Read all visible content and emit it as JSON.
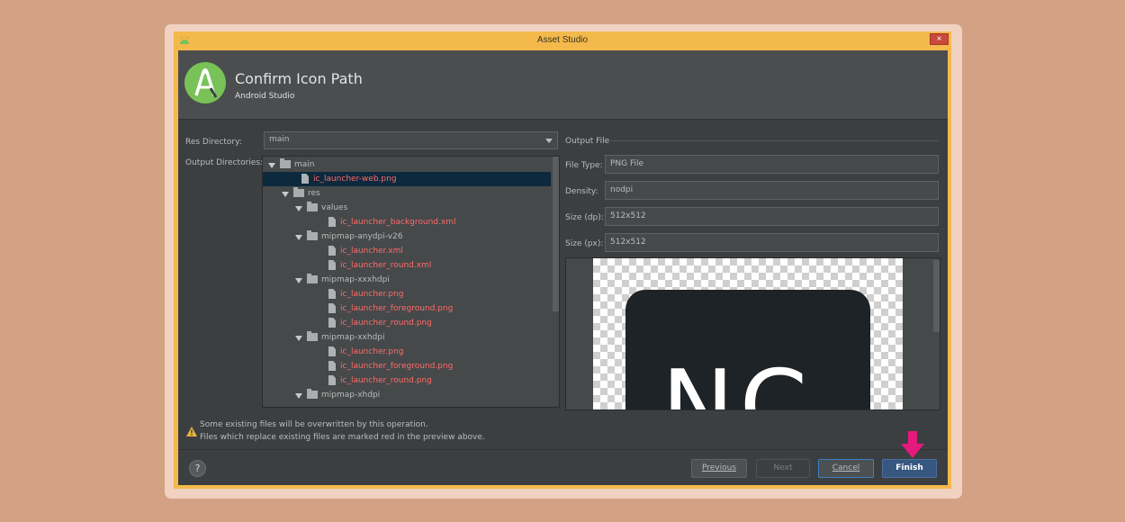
{
  "window": {
    "title": "Asset Studio",
    "close": "×"
  },
  "header": {
    "title": "Confirm Icon Path",
    "subtitle": "Android Studio"
  },
  "form": {
    "res_directory_label": "Res Directory:",
    "res_directory_value": "main",
    "output_directories_label": "Output Directories:"
  },
  "tree": [
    {
      "name": "main",
      "type": "folder",
      "depth": 0,
      "expanded": true,
      "red": false,
      "selected": false
    },
    {
      "name": "ic_launcher-web.png",
      "type": "file",
      "depth": 1,
      "red": true,
      "selected": true
    },
    {
      "name": "res",
      "type": "folder",
      "depth": 1,
      "expanded": true,
      "red": false,
      "selected": false
    },
    {
      "name": "values",
      "type": "folder",
      "depth": 2,
      "expanded": true,
      "red": false,
      "selected": false
    },
    {
      "name": "ic_launcher_background.xml",
      "type": "file",
      "depth": 3,
      "red": true,
      "selected": false
    },
    {
      "name": "mipmap-anydpi-v26",
      "type": "folder",
      "depth": 2,
      "expanded": true,
      "red": false,
      "selected": false
    },
    {
      "name": "ic_launcher.xml",
      "type": "file",
      "depth": 3,
      "red": true,
      "selected": false
    },
    {
      "name": "ic_launcher_round.xml",
      "type": "file",
      "depth": 3,
      "red": true,
      "selected": false
    },
    {
      "name": "mipmap-xxxhdpi",
      "type": "folder",
      "depth": 2,
      "expanded": true,
      "red": false,
      "selected": false
    },
    {
      "name": "ic_launcher.png",
      "type": "file",
      "depth": 3,
      "red": true,
      "selected": false
    },
    {
      "name": "ic_launcher_foreground.png",
      "type": "file",
      "depth": 3,
      "red": true,
      "selected": false
    },
    {
      "name": "ic_launcher_round.png",
      "type": "file",
      "depth": 3,
      "red": true,
      "selected": false
    },
    {
      "name": "mipmap-xxhdpi",
      "type": "folder",
      "depth": 2,
      "expanded": true,
      "red": false,
      "selected": false
    },
    {
      "name": "ic_launcher.png",
      "type": "file",
      "depth": 3,
      "red": true,
      "selected": false
    },
    {
      "name": "ic_launcher_foreground.png",
      "type": "file",
      "depth": 3,
      "red": true,
      "selected": false
    },
    {
      "name": "ic_launcher_round.png",
      "type": "file",
      "depth": 3,
      "red": true,
      "selected": false
    },
    {
      "name": "mipmap-xhdpi",
      "type": "folder",
      "depth": 2,
      "expanded": true,
      "red": false,
      "selected": false
    }
  ],
  "output": {
    "section_label": "Output File",
    "file_type_label": "File Type:",
    "file_type_value": "PNG File",
    "density_label": "Density:",
    "density_value": "nodpi",
    "size_dp_label": "Size (dp):",
    "size_dp_value": "512x512",
    "size_px_label": "Size (px):",
    "size_px_value": "512x512",
    "preview_text": "NC"
  },
  "warning": {
    "line1": "Some existing files will be overwritten by this operation.",
    "line2": "Files which replace existing files are marked red in the preview above."
  },
  "buttons": {
    "help": "?",
    "previous": "Previous",
    "next": "Next",
    "cancel": "Cancel",
    "finish": "Finish"
  },
  "colors": {
    "accent_arrow": "#e5197e",
    "overwrite_red": "#ff6b68",
    "logo_green": "#78c257",
    "selection": "#0d293e"
  }
}
